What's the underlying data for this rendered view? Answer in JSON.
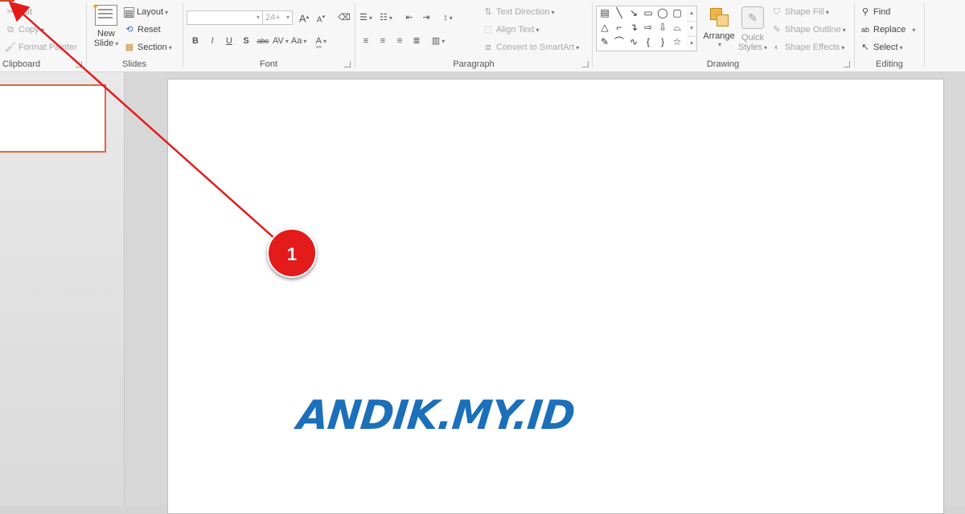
{
  "clipboard": {
    "label": "Clipboard",
    "cut": "Cut",
    "copy": "Copy",
    "format_painter": "Format Painter"
  },
  "slides": {
    "label": "Slides",
    "new_slide_line1": "New",
    "new_slide_line2": "Slide",
    "layout": "Layout",
    "reset": "Reset",
    "section": "Section"
  },
  "font": {
    "label": "Font",
    "font_name": "",
    "font_size": "24+",
    "bold": "B",
    "italic": "I",
    "underline": "U",
    "shadow": "S",
    "strike": "abc",
    "spacing": "AV",
    "case": "Aa",
    "color": "A",
    "grow": "A",
    "shrink": "A"
  },
  "paragraph": {
    "label": "Paragraph",
    "text_direction": "Text Direction",
    "align_text": "Align Text",
    "convert_smartart": "Convert to SmartArt"
  },
  "drawing": {
    "label": "Drawing",
    "arrange": "Arrange",
    "quick_styles_line1": "Quick",
    "quick_styles_line2": "Styles",
    "shape_fill": "Shape Fill",
    "shape_outline": "Shape Outline",
    "shape_effects": "Shape Effects",
    "shapes": [
      "▤",
      "╲",
      "↘",
      "▭",
      "◯",
      "▢",
      "△",
      "⌐",
      "↴",
      "⇨",
      "⇩",
      "⌓",
      "✎",
      "⌒",
      "∿",
      "{",
      "}",
      "☆"
    ]
  },
  "editing": {
    "label": "Editing",
    "find": "Find",
    "replace": "Replace",
    "select": "Select"
  },
  "slide_content": {
    "brand_text": "ANDIK.MY.ID"
  },
  "callout": {
    "number": "1"
  },
  "colors": {
    "accent": "#d24726",
    "brand": "#1c6fb9",
    "callout": "#e31b1b"
  }
}
